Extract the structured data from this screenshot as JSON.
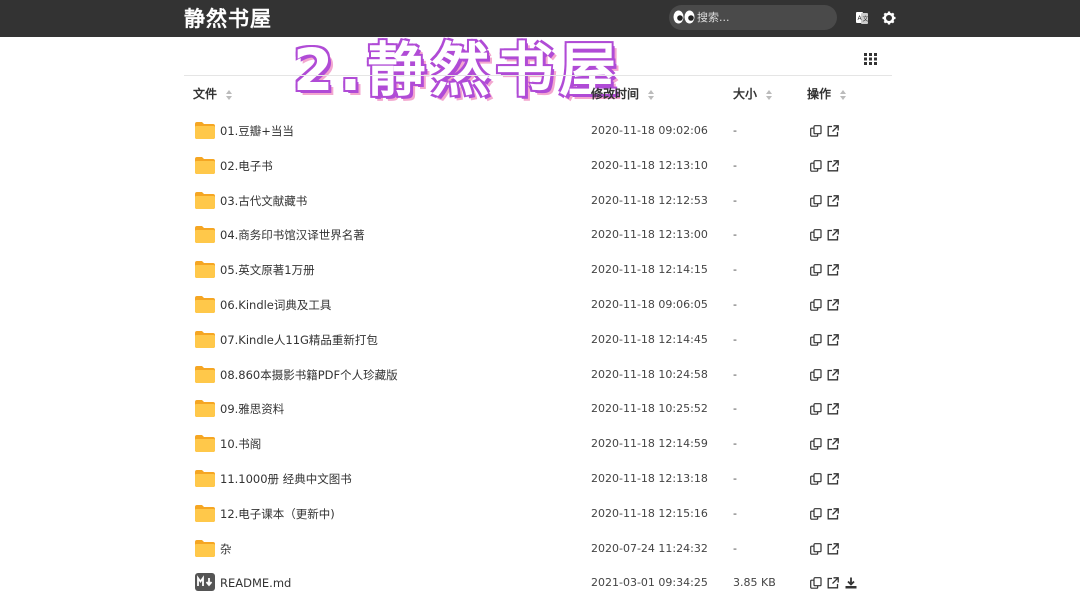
{
  "header": {
    "site_title": "静然书屋",
    "search_placeholder": "搜索...",
    "icons": [
      "translate-icon",
      "gear-icon",
      "eyes-icon",
      "grid-view-icon"
    ]
  },
  "overlay_title": "2.静然书屋",
  "table": {
    "columns": {
      "name": "文件",
      "modified": "修改时间",
      "size": "大小",
      "actions": "操作"
    },
    "rows": [
      {
        "name": "01.豆瓣+当当",
        "modified": "2020-11-18 09:02:06",
        "size": "-",
        "type": "folder"
      },
      {
        "name": "02.电子书",
        "modified": "2020-11-18 12:13:10",
        "size": "-",
        "type": "folder"
      },
      {
        "name": "03.古代文献藏书",
        "modified": "2020-11-18 12:12:53",
        "size": "-",
        "type": "folder"
      },
      {
        "name": "04.商务印书馆汉译世界名著",
        "modified": "2020-11-18 12:13:00",
        "size": "-",
        "type": "folder"
      },
      {
        "name": "05.英文原著1万册",
        "modified": "2020-11-18 12:14:15",
        "size": "-",
        "type": "folder"
      },
      {
        "name": "06.Kindle词典及工具",
        "modified": "2020-11-18 09:06:05",
        "size": "-",
        "type": "folder"
      },
      {
        "name": "07.Kindle人11G精品重新打包",
        "modified": "2020-11-18 12:14:45",
        "size": "-",
        "type": "folder"
      },
      {
        "name": "08.860本摄影书籍PDF个人珍藏版",
        "modified": "2020-11-18 10:24:58",
        "size": "-",
        "type": "folder"
      },
      {
        "name": "09.雅思资料",
        "modified": "2020-11-18 10:25:52",
        "size": "-",
        "type": "folder"
      },
      {
        "name": "10.书阁",
        "modified": "2020-11-18 12:14:59",
        "size": "-",
        "type": "folder"
      },
      {
        "name": "11.1000册 经典中文图书",
        "modified": "2020-11-18 12:13:18",
        "size": "-",
        "type": "folder"
      },
      {
        "name": "12.电子课本（更新中)",
        "modified": "2020-11-18 12:15:16",
        "size": "-",
        "type": "folder"
      },
      {
        "name": "杂",
        "modified": "2020-07-24 11:24:32",
        "size": "-",
        "type": "folder"
      },
      {
        "name": "README.md",
        "modified": "2021-03-01 09:34:25",
        "size": "3.85 KB",
        "type": "markdown"
      }
    ]
  },
  "colors": {
    "topbar": "#333333",
    "folder": "#FFB92E",
    "overlay_outline": "#b04bd6",
    "overlay_shadow": "#f3a7cf"
  }
}
